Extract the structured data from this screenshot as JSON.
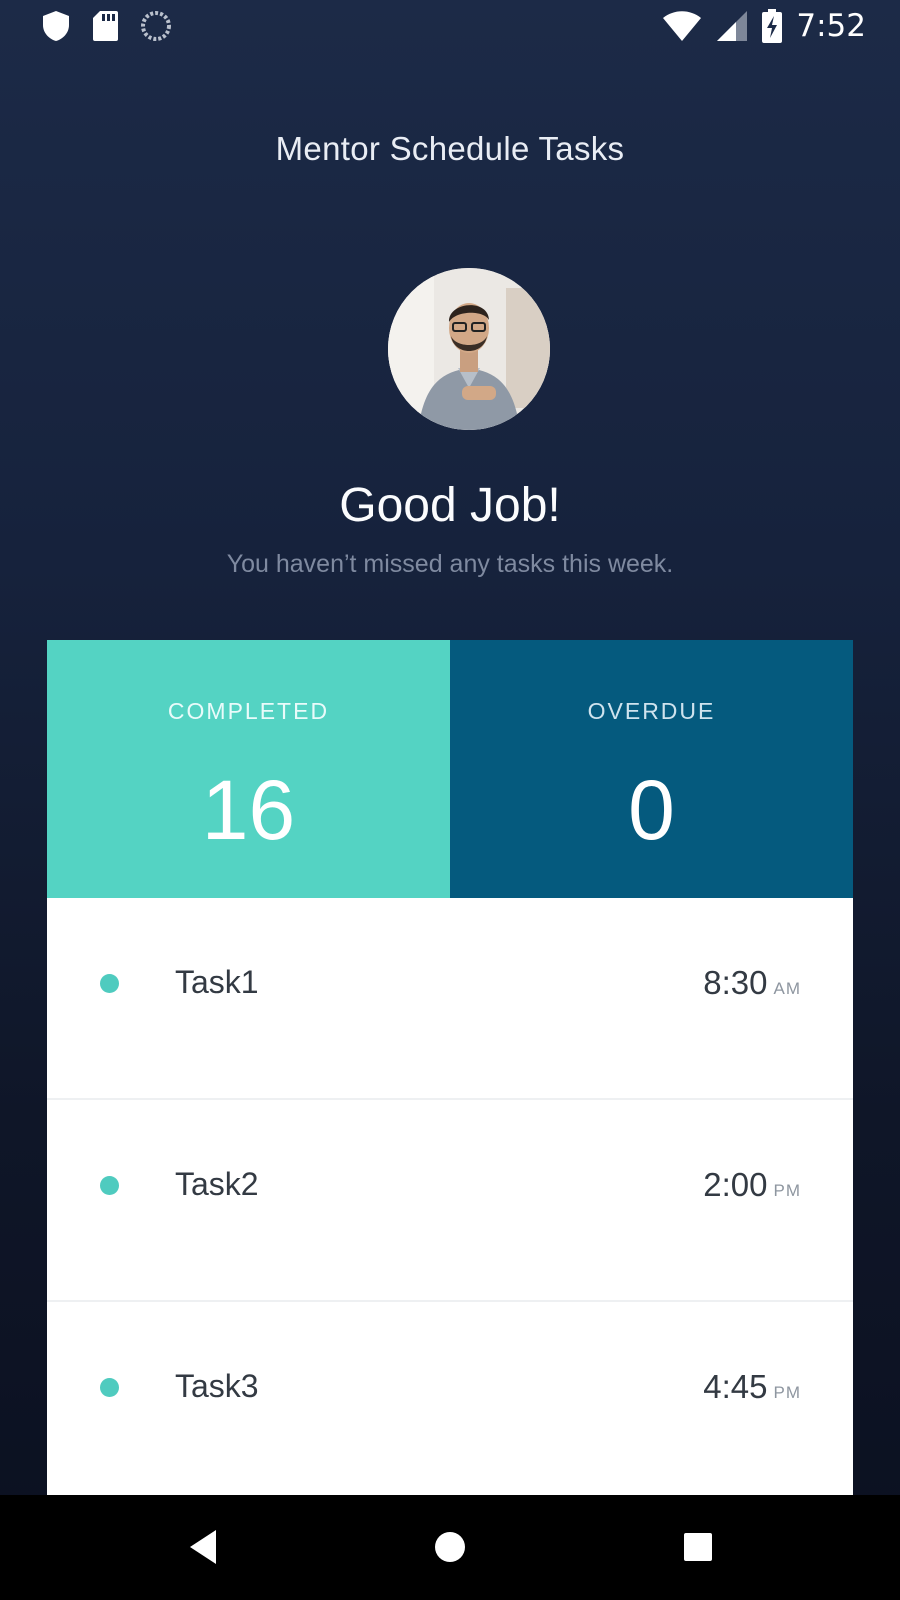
{
  "status_bar": {
    "time": "7:52",
    "left_icons": [
      "shield-icon",
      "sd-card-icon",
      "sync-icon"
    ],
    "right_icons": [
      "wifi-icon",
      "cell-signal-icon",
      "battery-charging-icon"
    ]
  },
  "header": {
    "title": "Mentor Schedule Tasks"
  },
  "profile": {
    "headline": "Good Job!",
    "subline": "You haven’t missed any tasks this week."
  },
  "stats": {
    "completed": {
      "label": "COMPLETED",
      "value": "16",
      "color": "#54d3c3"
    },
    "overdue": {
      "label": "OVERDUE",
      "value": "0",
      "color": "#055a7e"
    }
  },
  "tasks": [
    {
      "name": "Task1",
      "time": "8:30",
      "ampm": "AM"
    },
    {
      "name": "Task2",
      "time": "2:00",
      "ampm": "PM"
    },
    {
      "name": "Task3",
      "time": "4:45",
      "ampm": "PM"
    }
  ],
  "colors": {
    "background_top": "#1c2a47",
    "background_bottom": "#0b1020",
    "accent": "#54d3c3",
    "task_dot": "#4fcbbf"
  },
  "nav": {
    "buttons": [
      "back-icon",
      "home-icon",
      "recents-icon"
    ]
  }
}
